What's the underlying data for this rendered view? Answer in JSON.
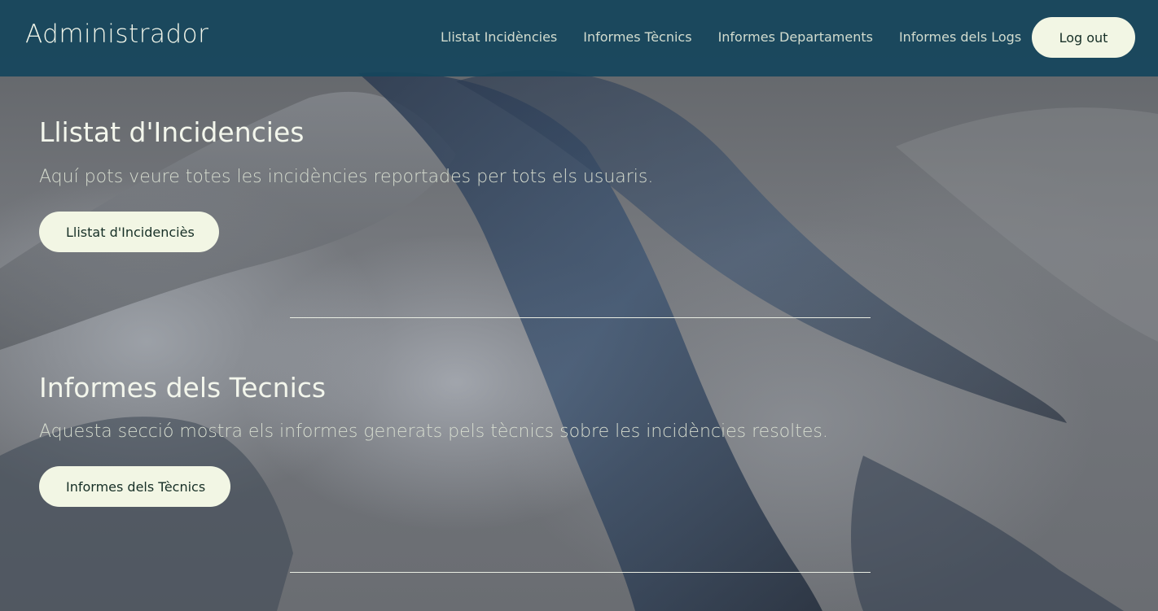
{
  "header": {
    "brand": "Administrador",
    "nav": [
      {
        "label": "Llistat Incidències"
      },
      {
        "label": "Informes Tècnics"
      },
      {
        "label": "Informes Departaments"
      },
      {
        "label": "Informes dels Logs"
      }
    ],
    "logout_label": "Log out"
  },
  "sections": [
    {
      "title": "Llistat d'Incidencies",
      "description": "Aquí pots veure totes les incidències reportades per tots els usuaris.",
      "button_label": "Llistat d'Incidenciès"
    },
    {
      "title": "Informes dels Tecnics",
      "description": "Aquesta secció mostra els informes generats pels tècnics sobre les incidències resoltes.",
      "button_label": "Informes dels Tècnics"
    }
  ],
  "colors": {
    "navbar": "#16465c",
    "button_bg": "#f2f6e4",
    "button_text": "#162f26",
    "title_text": "#f3f6ec"
  }
}
